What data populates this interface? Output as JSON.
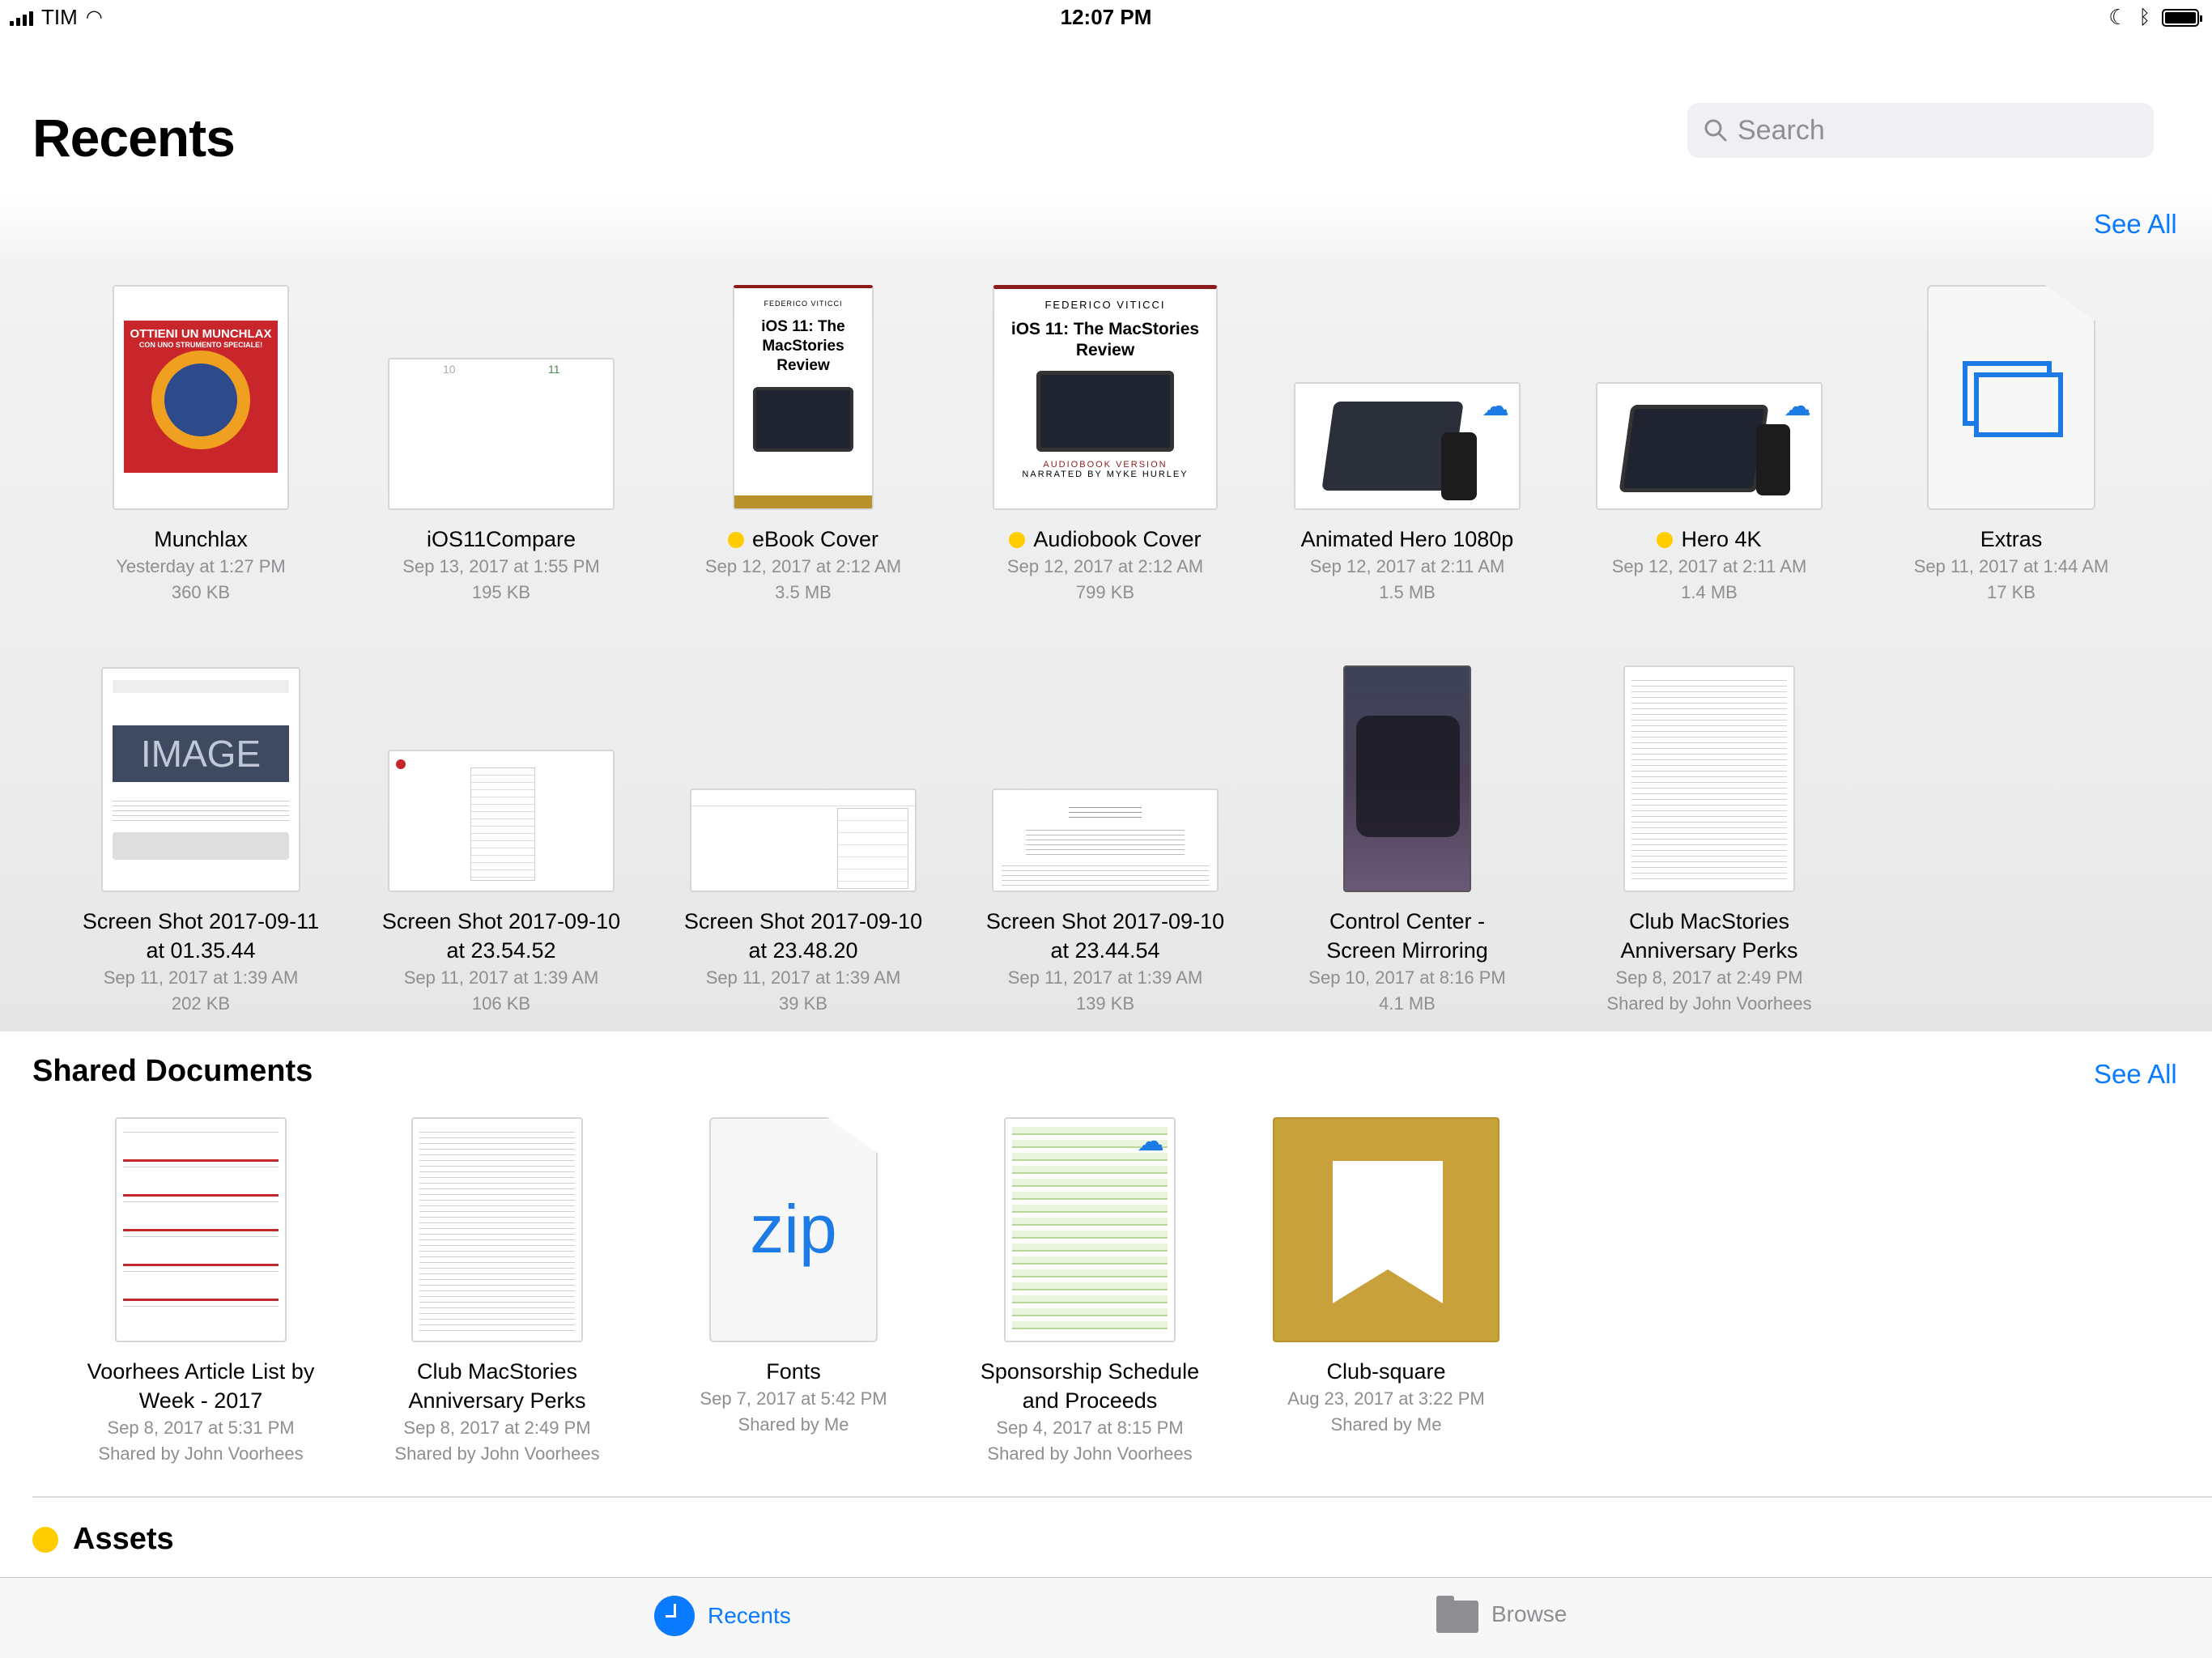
{
  "status": {
    "carrier": "TIM",
    "time": "12:07 PM"
  },
  "header": {
    "title": "Recents",
    "search_placeholder": "Search"
  },
  "recents": {
    "see_all": "See All",
    "items": [
      {
        "name": "Munchlax",
        "date": "Yesterday at 1:27 PM",
        "detail": "360 KB",
        "tag": false
      },
      {
        "name": "iOS11Compare",
        "date": "Sep 13, 2017 at 1:55 PM",
        "detail": "195 KB",
        "tag": false
      },
      {
        "name": "eBook Cover",
        "date": "Sep 12, 2017 at 2:12 AM",
        "detail": "3.5 MB",
        "tag": true
      },
      {
        "name": "Audiobook Cover",
        "date": "Sep 12, 2017 at 2:12 AM",
        "detail": "799 KB",
        "tag": true
      },
      {
        "name": "Animated Hero 1080p",
        "date": "Sep 12, 2017 at 2:11 AM",
        "detail": "1.5 MB",
        "tag": false
      },
      {
        "name": "Hero 4K",
        "date": "Sep 12, 2017 at 2:11 AM",
        "detail": "1.4 MB",
        "tag": true
      },
      {
        "name": "Extras",
        "date": "Sep 11, 2017 at 1:44 AM",
        "detail": "17 KB",
        "tag": false
      },
      {
        "name": "Screen Shot 2017-09-11",
        "name2": "at 01.35.44",
        "date": "Sep 11, 2017 at 1:39 AM",
        "detail": "202 KB",
        "tag": false
      },
      {
        "name": "Screen Shot 2017-09-10",
        "name2": "at 23.54.52",
        "date": "Sep 11, 2017 at 1:39 AM",
        "detail": "106 KB",
        "tag": false
      },
      {
        "name": "Screen Shot 2017-09-10",
        "name2": "at 23.48.20",
        "date": "Sep 11, 2017 at 1:39 AM",
        "detail": "39 KB",
        "tag": false
      },
      {
        "name": "Screen Shot 2017-09-10",
        "name2": "at 23.44.54",
        "date": "Sep 11, 2017 at 1:39 AM",
        "detail": "139 KB",
        "tag": false
      },
      {
        "name": "Control Center -",
        "name2": "Screen Mirroring",
        "date": "Sep 10, 2017 at 8:16 PM",
        "detail": "4.1 MB",
        "tag": false
      },
      {
        "name": "Club MacStories",
        "name2": "Anniversary Perks",
        "date": "Sep 8, 2017 at 2:49 PM",
        "detail": "Shared by John Voorhees",
        "tag": false
      }
    ]
  },
  "thumb_text": {
    "munchlax_line1": "OTTIENI UN MUNCHLAX",
    "munchlax_line2": "CON UNO STRUMENTO SPECIALE!",
    "ebook_author": "FEDERICO VITICCI",
    "ebook_title": "iOS 11: The MacStories Review",
    "audio_author": "FEDERICO VITICCI",
    "audio_title": "iOS 11: The MacStories Review",
    "audio_footer1": "AUDIOBOOK VERSION",
    "audio_footer2": "NARRATED BY MYKE HURLEY",
    "compare_a": "10",
    "compare_b": "11",
    "image_placeholder": "IMAGE",
    "zip_label": "zip"
  },
  "shared": {
    "title": "Shared Documents",
    "see_all": "See All",
    "items": [
      {
        "name": "Voorhees Article List by",
        "name2": "Week - 2017",
        "date": "Sep 8, 2017 at 5:31 PM",
        "detail": "Shared by John Voorhees"
      },
      {
        "name": "Club MacStories",
        "name2": "Anniversary Perks",
        "date": "Sep 8, 2017 at 2:49 PM",
        "detail": "Shared by John Voorhees"
      },
      {
        "name": "Fonts",
        "date": "Sep 7, 2017 at 5:42 PM",
        "detail": "Shared by Me"
      },
      {
        "name": "Sponsorship Schedule",
        "name2": "and Proceeds",
        "date": "Sep 4, 2017 at 8:15 PM",
        "detail": "Shared by John Voorhees"
      },
      {
        "name": "Club-square",
        "date": "Aug 23, 2017 at 3:22 PM",
        "detail": "Shared by Me"
      }
    ]
  },
  "assets": {
    "title": "Assets",
    "tag_color": "#ffcc00"
  },
  "tabs": {
    "recents": "Recents",
    "browse": "Browse"
  },
  "colors": {
    "accent": "#0a7aff",
    "club_gold": "#c9a13a",
    "tag_yellow": "#ffcc00"
  }
}
